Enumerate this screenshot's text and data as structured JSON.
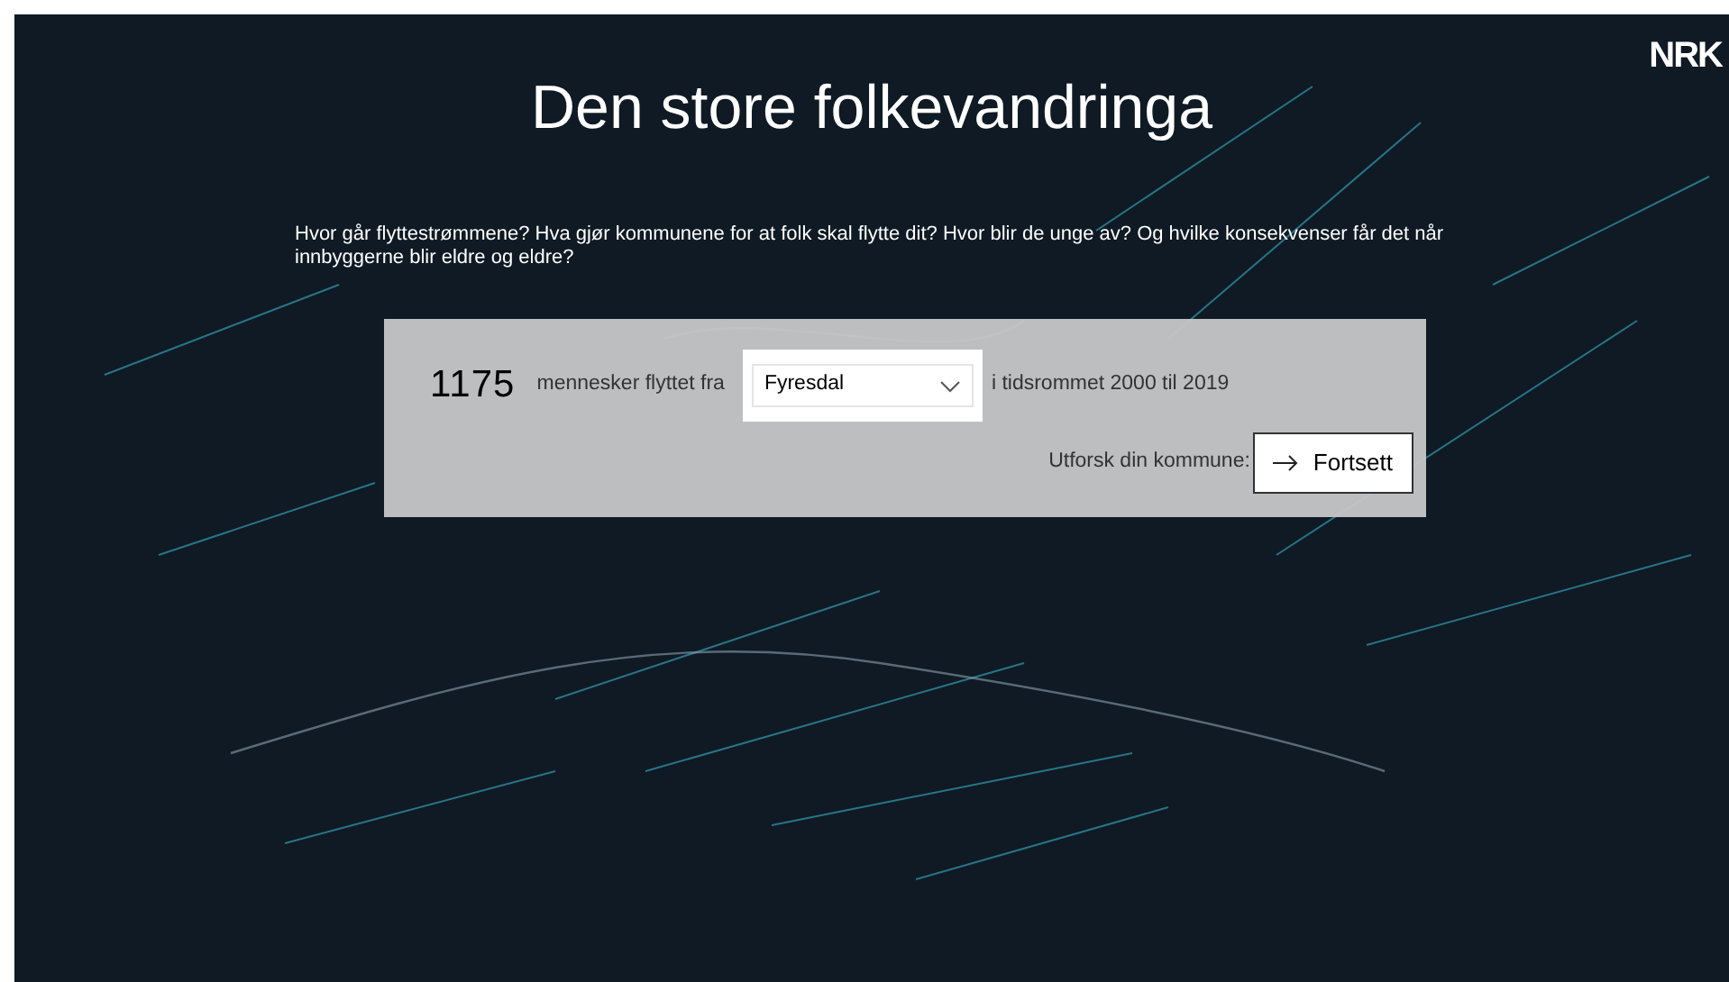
{
  "logo": {
    "text": "NRK"
  },
  "title": "Den store folkevandringa",
  "intro": "Hvor går flyttestrømmene? Hva gjør kommunene for at folk skal flytte dit? Hvor blir de unge av? Og hvilke konsekvenser får det når innbyggerne blir eldre og eldre?",
  "panel": {
    "count": "1175",
    "text_before": "mennesker flyttet fra",
    "dropdown": {
      "value": "Fyresdal"
    },
    "text_after": "i tidsrommet 2000 til 2019",
    "explore_label": "Utforsk din kommune:",
    "button": {
      "label": "Fortsett"
    }
  }
}
